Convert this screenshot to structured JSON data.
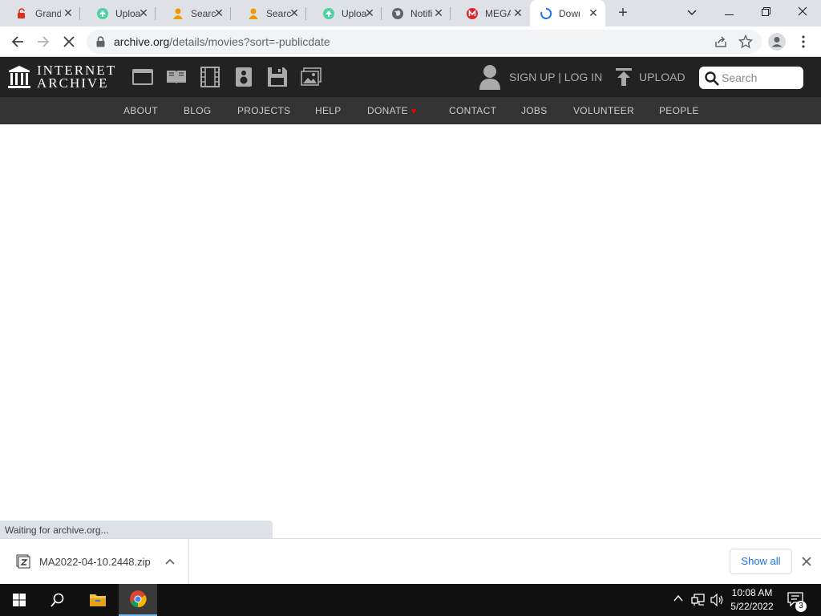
{
  "browser": {
    "tabs": [
      {
        "label": "Grand",
        "icon": "lock-red-icon"
      },
      {
        "label": "Uploa",
        "icon": "upload-green-icon"
      },
      {
        "label": "Searc",
        "icon": "person-orange-icon"
      },
      {
        "label": "Searc",
        "icon": "person-orange-icon"
      },
      {
        "label": "Uploa",
        "icon": "upload-green-icon"
      },
      {
        "label": "Notifi",
        "icon": "globe-icon"
      },
      {
        "label": "MEGA",
        "icon": "mega-icon"
      },
      {
        "label": "Down",
        "icon": "loading-spinner-icon",
        "active": true
      }
    ],
    "url_host": "archive.org",
    "url_path": "/details/movies?sort=-publicdate",
    "status_text": "Waiting for archive.org..."
  },
  "ia": {
    "logo_line1": "INTERNET",
    "logo_line2": "ARCHIVE",
    "signup_label": "SIGN UP | LOG IN",
    "upload_label": "UPLOAD",
    "search_placeholder": "Search",
    "nav": [
      "ABOUT",
      "BLOG",
      "PROJECTS",
      "HELP",
      "DONATE",
      "CONTACT",
      "JOBS",
      "VOLUNTEER",
      "PEOPLE"
    ]
  },
  "downloads": {
    "file_name": "MA2022-04-10.2448.zip",
    "show_all_label": "Show all"
  },
  "taskbar": {
    "time": "10:08 AM",
    "date": "5/22/2022",
    "notification_count": "3"
  },
  "colors": {
    "ia_header": "#222222",
    "ia_nav": "#333333",
    "link_blue": "#1a73e8",
    "heart_red": "#ee0000"
  }
}
